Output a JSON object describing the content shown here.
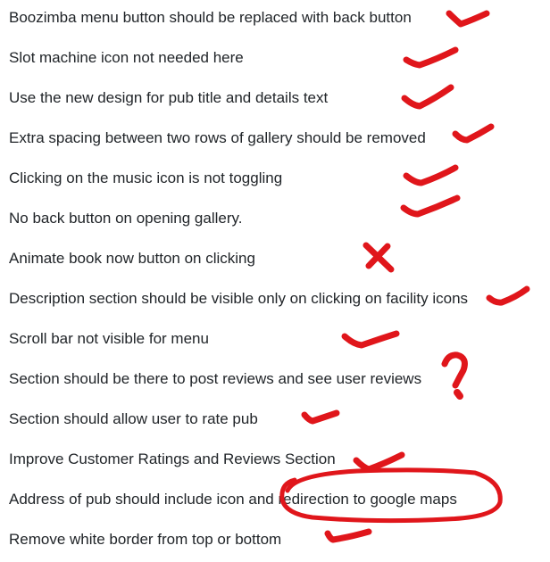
{
  "feedback_list": {
    "items": [
      {
        "text": "Boozimba menu button should be replaced with back button",
        "mark": "check"
      },
      {
        "text": "Slot machine icon not needed here",
        "mark": "check"
      },
      {
        "text": "Use the new design for pub title and details text",
        "mark": "check"
      },
      {
        "text": "Extra spacing between two rows of gallery should be removed",
        "mark": "check"
      },
      {
        "text": "Clicking on the music icon is not toggling",
        "mark": "check"
      },
      {
        "text": "No back button on opening gallery.",
        "mark": "check"
      },
      {
        "text": "Animate book now button on clicking",
        "mark": "cross"
      },
      {
        "text": "Description section should be visible only on clicking on facility icons",
        "mark": "check"
      },
      {
        "text": "Scroll bar not visible for menu",
        "mark": "check"
      },
      {
        "text": "Section should be there to post reviews and see user reviews",
        "mark": "question"
      },
      {
        "text": "Section should allow user to rate pub",
        "mark": "check"
      },
      {
        "text": "Improve Customer Ratings and Reviews Section",
        "mark": "check"
      },
      {
        "text": "Address of pub should include icon and redirection to google maps",
        "mark": "check",
        "circled_text": "redirection to google maps"
      },
      {
        "text": "Remove white border from top or bottom",
        "mark": "check"
      }
    ]
  },
  "colors": {
    "text": "#212529",
    "annotation_red": "#e0161b",
    "background": "#ffffff"
  }
}
